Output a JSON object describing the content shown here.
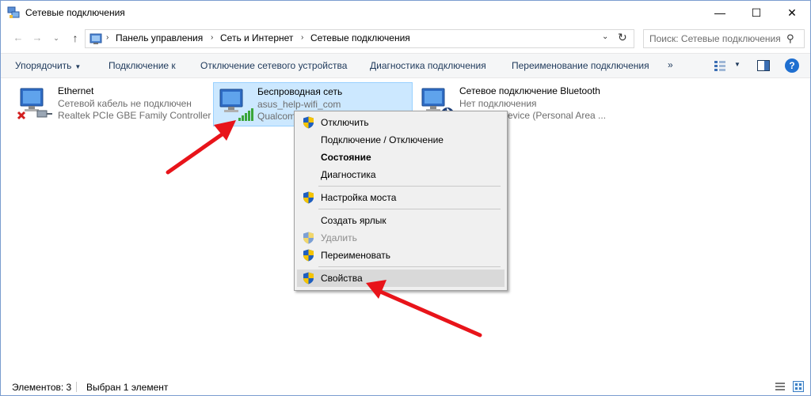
{
  "window": {
    "title": "Сетевые подключения",
    "controls": {
      "minimize": "—",
      "maximize": "☐",
      "close": "✕"
    }
  },
  "nav": {
    "back": "←",
    "forward": "→",
    "history": "⌄",
    "up": "↑"
  },
  "address": {
    "crumbs": [
      "Панель управления",
      "Сеть и Интернет",
      "Сетевые подключения"
    ],
    "separator": "›",
    "dropdown": "⌄",
    "refresh": "↻"
  },
  "search": {
    "placeholder": "Поиск: Сетевые подключения",
    "icon": "⚲"
  },
  "toolbar": {
    "organize": "Упорядочить",
    "organize_arrow": "▼",
    "connect_to": "Подключение к",
    "disable_device": "Отключение сетевого устройства",
    "diagnose": "Диагностика подключения",
    "rename": "Переименование подключения",
    "more": "»",
    "view_drop": "▼",
    "help": "?"
  },
  "connections": [
    {
      "name": "Ethernet",
      "status": "Сетевой кабель не подключен",
      "device": "Realtek PCIe GBE Family Controller"
    },
    {
      "name": "Беспроводная сеть",
      "status": "asus_help-wifi_com",
      "device": "Qualcomm Atheros",
      "device_visible": "Qualcom"
    },
    {
      "name": "Сетевое подключение Bluetooth",
      "status": "Нет подключения",
      "device": "Bluetooth Device (Personal Area Network)",
      "device_visible": "evice (Personal Area ..."
    }
  ],
  "context_menu": {
    "items": [
      {
        "label": "Отключить",
        "shield": true,
        "bold": false,
        "disabled": false
      },
      {
        "label": "Подключение / Отключение",
        "shield": false,
        "bold": false,
        "disabled": false
      },
      {
        "label": "Состояние",
        "shield": false,
        "bold": true,
        "disabled": false
      },
      {
        "label": "Диагностика",
        "shield": false,
        "bold": false,
        "disabled": false
      },
      {
        "label": "Настройка моста",
        "shield": true,
        "bold": false,
        "disabled": false
      },
      {
        "label": "Создать ярлык",
        "shield": false,
        "bold": false,
        "disabled": false
      },
      {
        "label": "Удалить",
        "shield": true,
        "bold": false,
        "disabled": true
      },
      {
        "label": "Переименовать",
        "shield": true,
        "bold": false,
        "disabled": false
      },
      {
        "label": "Свойства",
        "shield": true,
        "bold": false,
        "disabled": false,
        "highlighted": true
      }
    ]
  },
  "status_bar": {
    "items_count": "Элементов: 3",
    "selected": "Выбран 1 элемент"
  },
  "colors": {
    "selection_bg": "#cce8ff",
    "selection_border": "#99d1ff",
    "annotation_arrow": "#e8141a",
    "shield_blue": "#1f5fbf",
    "shield_yellow": "#f5c400"
  },
  "icons": {
    "window": "network-connections-icon",
    "ethernet": "monitor-network-disconnected-icon",
    "wifi": "monitor-wifi-signal-icon",
    "bluetooth": "monitor-bluetooth-icon",
    "uac": "uac-shield-icon"
  }
}
